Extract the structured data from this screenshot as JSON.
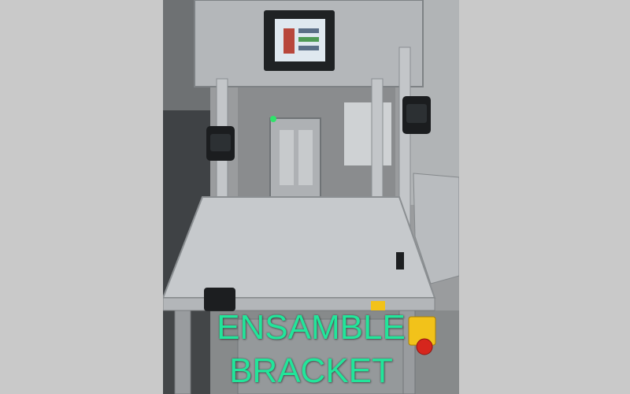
{
  "caption": {
    "line1": "ENSAMBLE",
    "line2": "BRACKET"
  },
  "colors": {
    "page_background": "#c9c9c9",
    "caption_text": "#22e59a",
    "estop_yellow": "#f2c21a",
    "estop_red": "#d6261d",
    "machine_aluminum": "#b9bcbf"
  }
}
